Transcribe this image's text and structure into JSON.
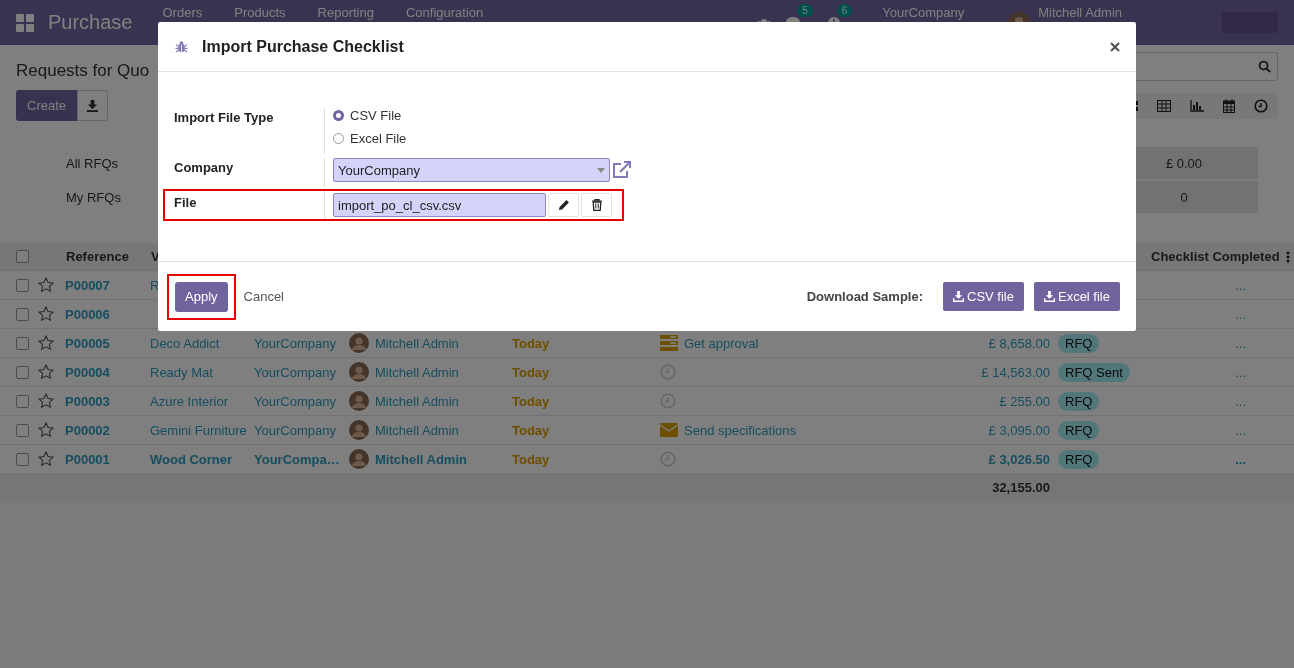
{
  "navbar": {
    "app_name": "Purchase",
    "menu": [
      "Orders",
      "Products",
      "Reporting",
      "Configuration"
    ],
    "chat_count": "5",
    "activity_count": "6",
    "company": "YourCompany",
    "user": "Mitchell Admin"
  },
  "control_panel": {
    "title": "Requests for Quo",
    "create_button": "Create"
  },
  "dashboard": [
    {
      "label": "All RFQs",
      "value": "£ 0.00"
    },
    {
      "label": "My RFQs",
      "value": "0"
    }
  ],
  "table": {
    "all_selected": false,
    "columns": [
      "Reference",
      "V",
      "Checklist Completed"
    ],
    "rows": [
      {
        "selected": false,
        "starred": false,
        "emphasized": false,
        "reference": "P00007",
        "vendor": "R",
        "checklist": "..."
      },
      {
        "selected": false,
        "starred": false,
        "emphasized": false,
        "reference": "P00006",
        "checklist": "..."
      },
      {
        "selected": false,
        "starred": false,
        "emphasized": false,
        "reference": "P00005",
        "vendor": "Deco Addict",
        "company": "YourCompany",
        "buyer": "Mitchell Admin",
        "date": "Today",
        "activity": {
          "kind": "approval",
          "text": "Get approval"
        },
        "amount": "£ 8,658.00",
        "status": "RFQ",
        "checklist": "..."
      },
      {
        "selected": false,
        "starred": false,
        "emphasized": false,
        "reference": "P00004",
        "vendor": "Ready Mat",
        "company": "YourCompany",
        "buyer": "Mitchell Admin",
        "date": "Today",
        "activity": {
          "kind": "none"
        },
        "amount": "£ 14,563.00",
        "status": "RFQ Sent",
        "checklist": "..."
      },
      {
        "selected": false,
        "starred": false,
        "emphasized": false,
        "reference": "P00003",
        "vendor": "Azure Interior",
        "company": "YourCompany",
        "buyer": "Mitchell Admin",
        "date": "Today",
        "activity": {
          "kind": "none"
        },
        "amount": "£ 255.00",
        "status": "RFQ",
        "checklist": "..."
      },
      {
        "selected": false,
        "starred": false,
        "emphasized": false,
        "reference": "P00002",
        "vendor": "Gemini Furniture",
        "company": "YourCompany",
        "buyer": "Mitchell Admin",
        "date": "Today",
        "activity": {
          "kind": "email",
          "text": "Send specifications"
        },
        "amount": "£ 3,095.00",
        "status": "RFQ",
        "checklist": "..."
      },
      {
        "selected": false,
        "starred": false,
        "emphasized": true,
        "reference": "P00001",
        "vendor": "Wood Corner",
        "company": "YourCompa…",
        "buyer": "Mitchell Admin",
        "date": "Today",
        "activity": {
          "kind": "none"
        },
        "amount": "£ 3,026.50",
        "status": "RFQ",
        "checklist": "..."
      }
    ],
    "total": "32,155.00"
  },
  "modal": {
    "title": "Import Purchase Checklist",
    "file_type": {
      "label": "Import File Type",
      "options": [
        {
          "label": "CSV File",
          "selected": true
        },
        {
          "label": "Excel File",
          "selected": false
        }
      ]
    },
    "company": {
      "label": "Company",
      "value": "YourCompany"
    },
    "file": {
      "label": "File",
      "value": "import_po_cl_csv.csv",
      "highlighted": true
    },
    "apply": {
      "label": "Apply",
      "highlighted": true
    },
    "cancel": "Cancel",
    "download_label": "Download Sample:",
    "downloads": [
      "CSV file",
      "Excel file"
    ]
  }
}
